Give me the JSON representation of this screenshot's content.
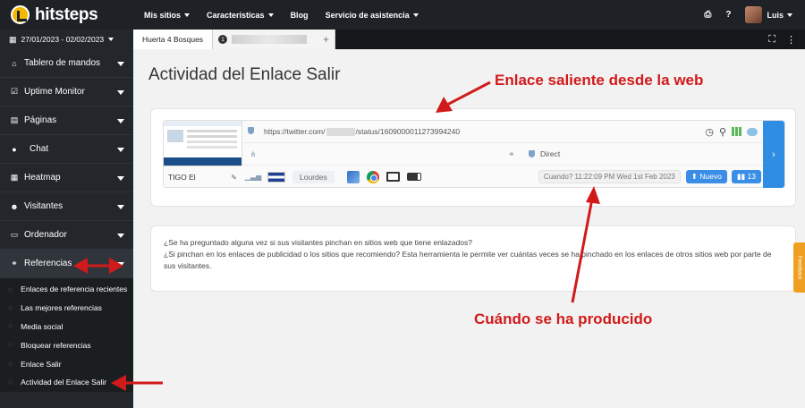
{
  "app": {
    "logo": "hitsteps"
  },
  "topnav": [
    {
      "label": "Mis sitios",
      "caret": true
    },
    {
      "label": "Características",
      "caret": true
    },
    {
      "label": "Blog",
      "caret": false
    },
    {
      "label": "Servicio de asistencia",
      "caret": true
    }
  ],
  "user": {
    "name": "Luis",
    "print_icon": "⎙",
    "help_icon": "?"
  },
  "date_range": "27/01/2023 - 02/02/2023",
  "tabs": {
    "first": "Huerta 4 Bosques",
    "second_badge": "1",
    "plus": "+"
  },
  "sidebar": {
    "items": [
      {
        "label": "Tablero de mandos",
        "icon": "⌂"
      },
      {
        "label": "Uptime Monitor",
        "icon": "☑"
      },
      {
        "label": "Páginas",
        "icon": "▤"
      },
      {
        "label": "Chat",
        "icon": "●"
      },
      {
        "label": "Heatmap",
        "icon": "▦"
      },
      {
        "label": "Visitantes",
        "icon": "☻"
      },
      {
        "label": "Ordenador",
        "icon": "▭"
      },
      {
        "label": "Referencias",
        "icon": "⚭"
      }
    ],
    "sub_items": [
      "Enlaces de referencia recientes",
      "Las mejores referencias",
      "Media social",
      "Bloquear referencias",
      "Enlace Salir",
      "Actividad del Enlace Salir"
    ]
  },
  "page": {
    "title": "Actividad del Enlace Salir"
  },
  "visit": {
    "url_prefix": "https://twitter.com/",
    "url_suffix": "/status/1609000011273994240",
    "referrer": "Direct",
    "visitor_name": "TIGO El",
    "city": "Lourdes",
    "when": "Cuando? 11:22:09 PM Wed 1st Feb 2023",
    "new_label": "Nuevo",
    "count": "13"
  },
  "info": {
    "line1": "¿Se ha preguntado alguna vez si sus visitantes pinchan en sitios web que tiene enlazados?",
    "line2": "¿Si pinchan en los enlaces de publicidad o los sitios que recomiendo? Esta herramienta le permite ver cuántas veces se ha pinchado en los enlaces de otros sitios web por parte de sus visitantes."
  },
  "feedback": "Feedback",
  "annotations": {
    "outgoing": "Enlace saliente desde la web",
    "when": "Cuándo se ha producido"
  },
  "colors": {
    "accent": "#2f8de4",
    "annotation": "#d11a1a",
    "sidebar": "#23272b"
  }
}
